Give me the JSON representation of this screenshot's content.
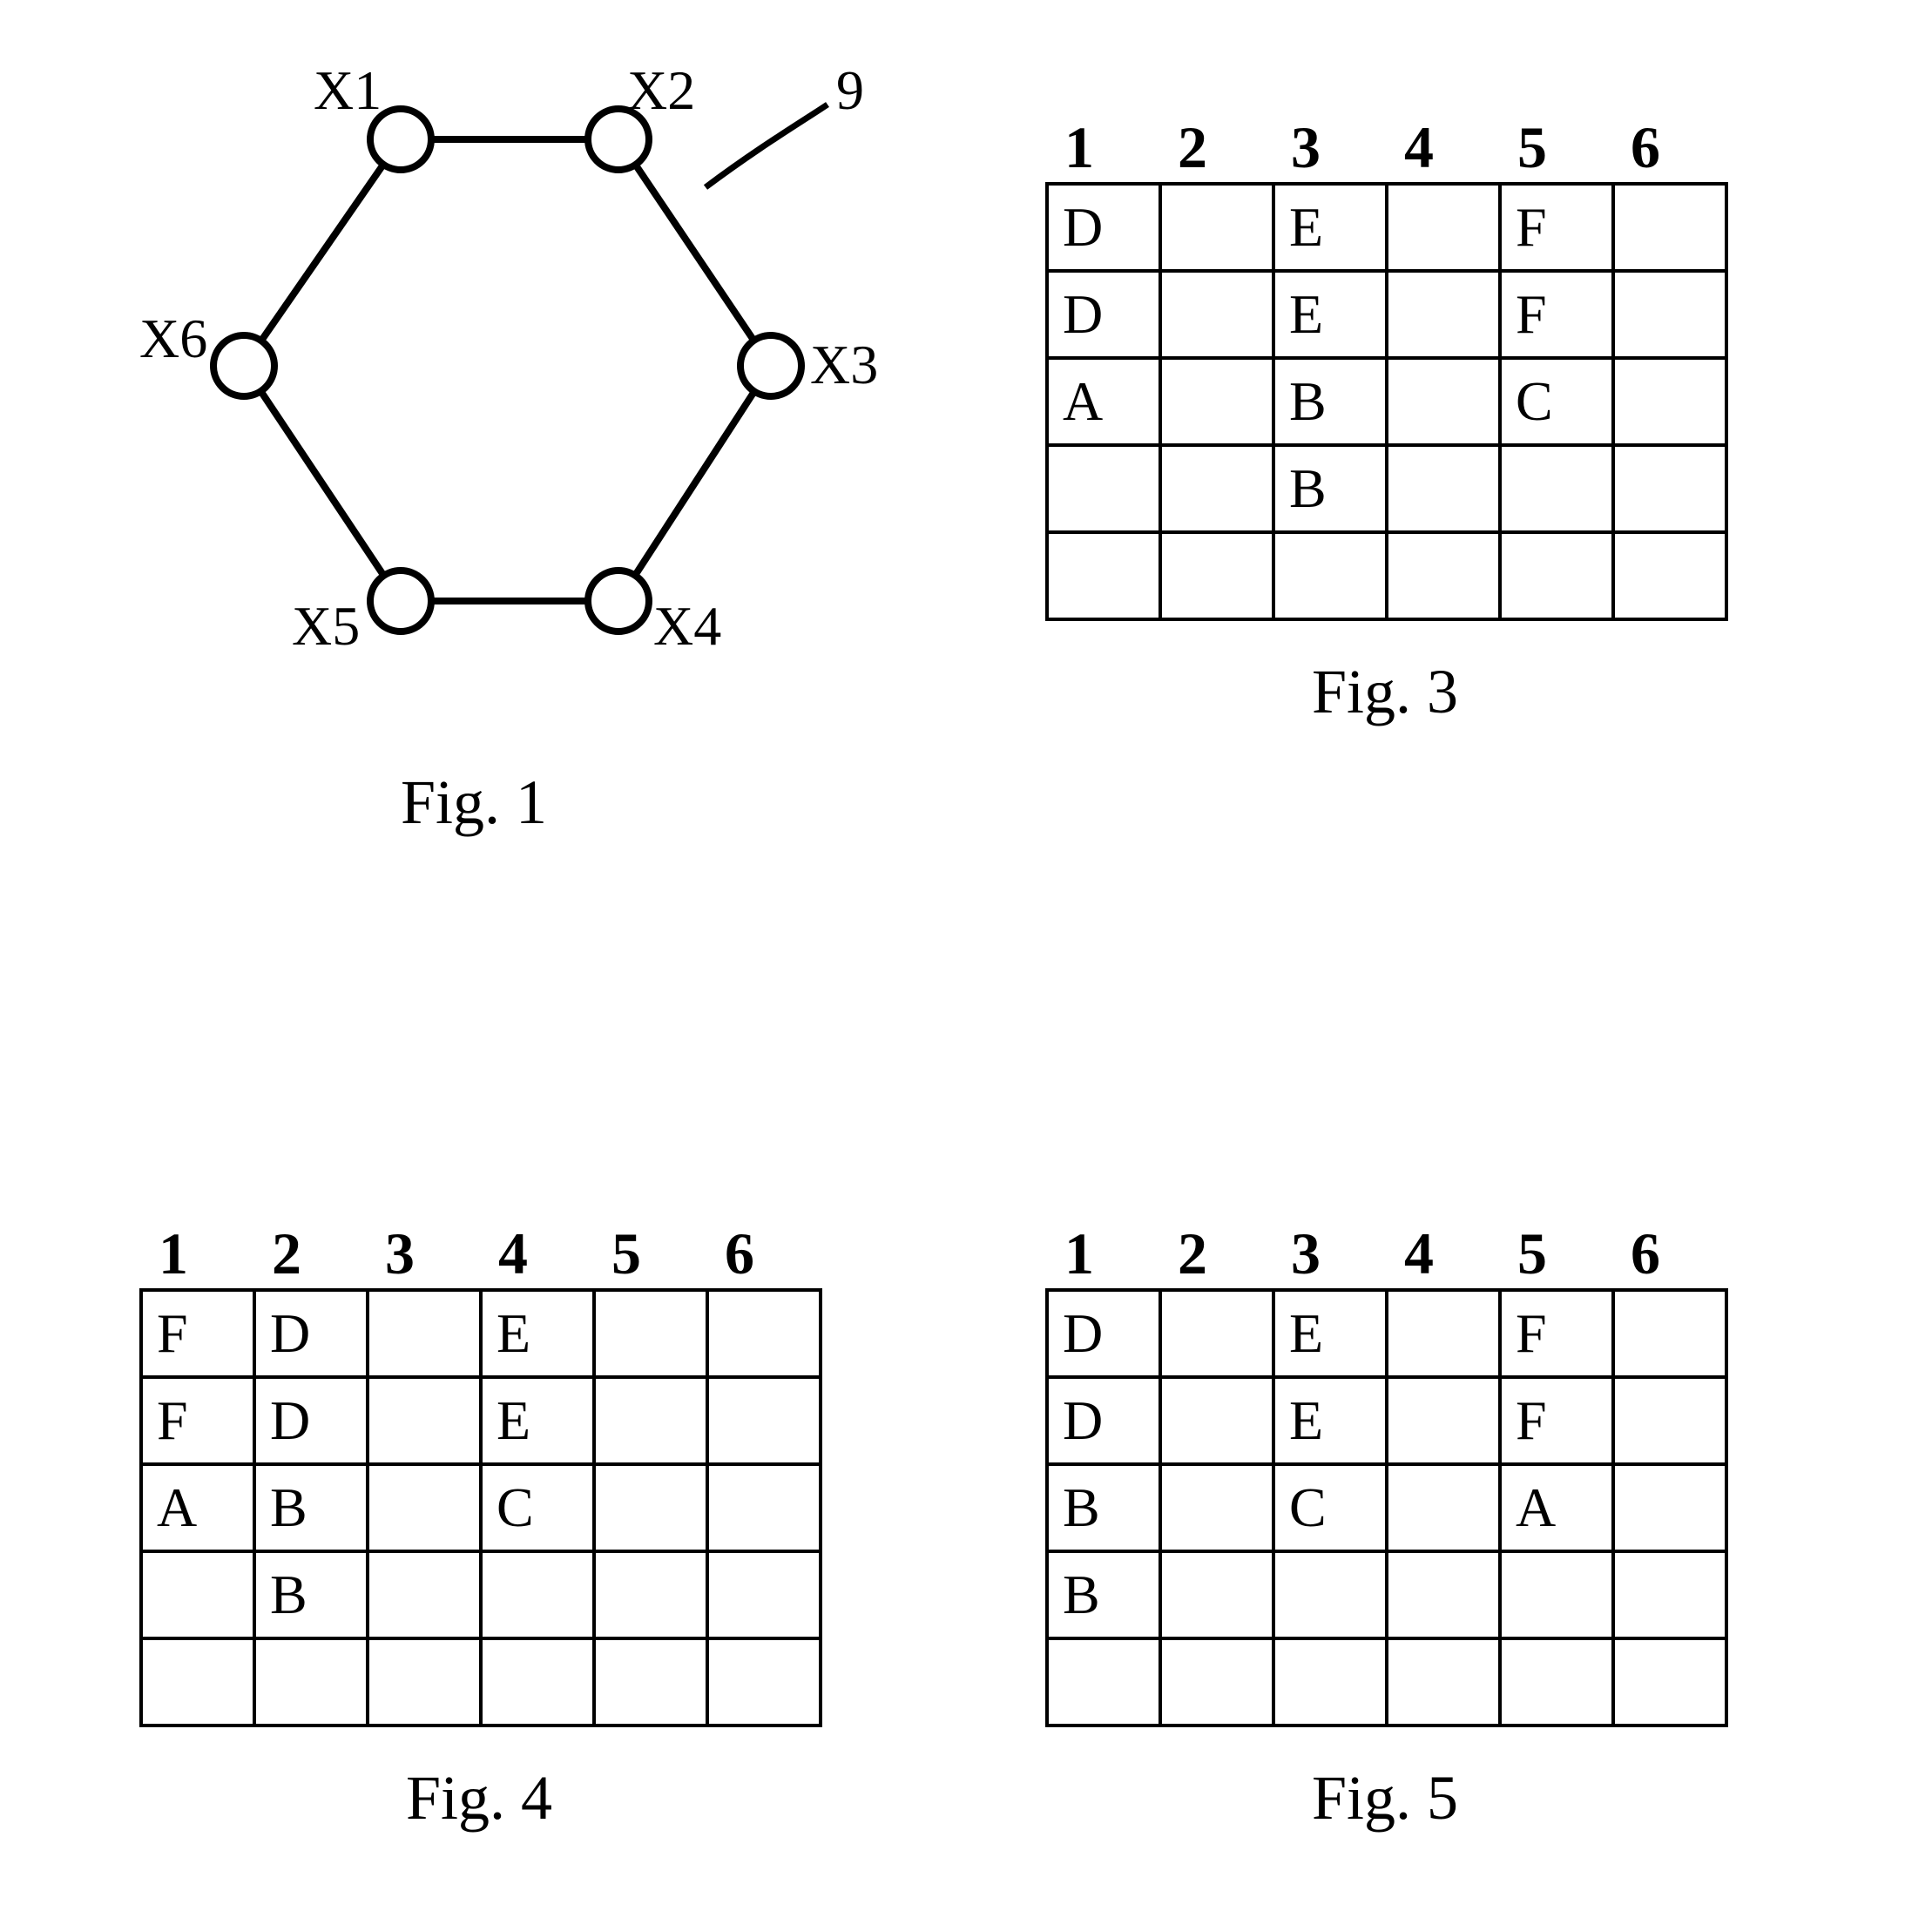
{
  "fig1": {
    "caption": "Fig. 1",
    "callout": "9",
    "nodes": [
      "X1",
      "X2",
      "X3",
      "X4",
      "X5",
      "X6"
    ]
  },
  "fig3": {
    "caption": "Fig. 3",
    "headers": [
      "1",
      "2",
      "3",
      "4",
      "5",
      "6"
    ],
    "rows": [
      [
        "D",
        "",
        "E",
        "",
        "F",
        ""
      ],
      [
        "D",
        "",
        "E",
        "",
        "F",
        ""
      ],
      [
        "A",
        "",
        "B",
        "",
        "C",
        ""
      ],
      [
        "",
        "",
        "B",
        "",
        "",
        ""
      ],
      [
        "",
        "",
        "",
        "",
        "",
        ""
      ]
    ]
  },
  "fig4": {
    "caption": "Fig. 4",
    "headers": [
      "1",
      "2",
      "3",
      "4",
      "5",
      "6"
    ],
    "rows": [
      [
        "F",
        "D",
        "",
        "E",
        "",
        ""
      ],
      [
        "F",
        "D",
        "",
        "E",
        "",
        ""
      ],
      [
        "A",
        "B",
        "",
        "C",
        "",
        ""
      ],
      [
        "",
        "B",
        "",
        "",
        "",
        ""
      ],
      [
        "",
        "",
        "",
        "",
        "",
        ""
      ]
    ]
  },
  "fig5": {
    "caption": "Fig. 5",
    "headers": [
      "1",
      "2",
      "3",
      "4",
      "5",
      "6"
    ],
    "rows": [
      [
        "D",
        "",
        "E",
        "",
        "F",
        ""
      ],
      [
        "D",
        "",
        "E",
        "",
        "F",
        ""
      ],
      [
        "B",
        "",
        "C",
        "",
        "A",
        ""
      ],
      [
        "B",
        "",
        "",
        "",
        "",
        ""
      ],
      [
        "",
        "",
        "",
        "",
        "",
        ""
      ]
    ]
  }
}
